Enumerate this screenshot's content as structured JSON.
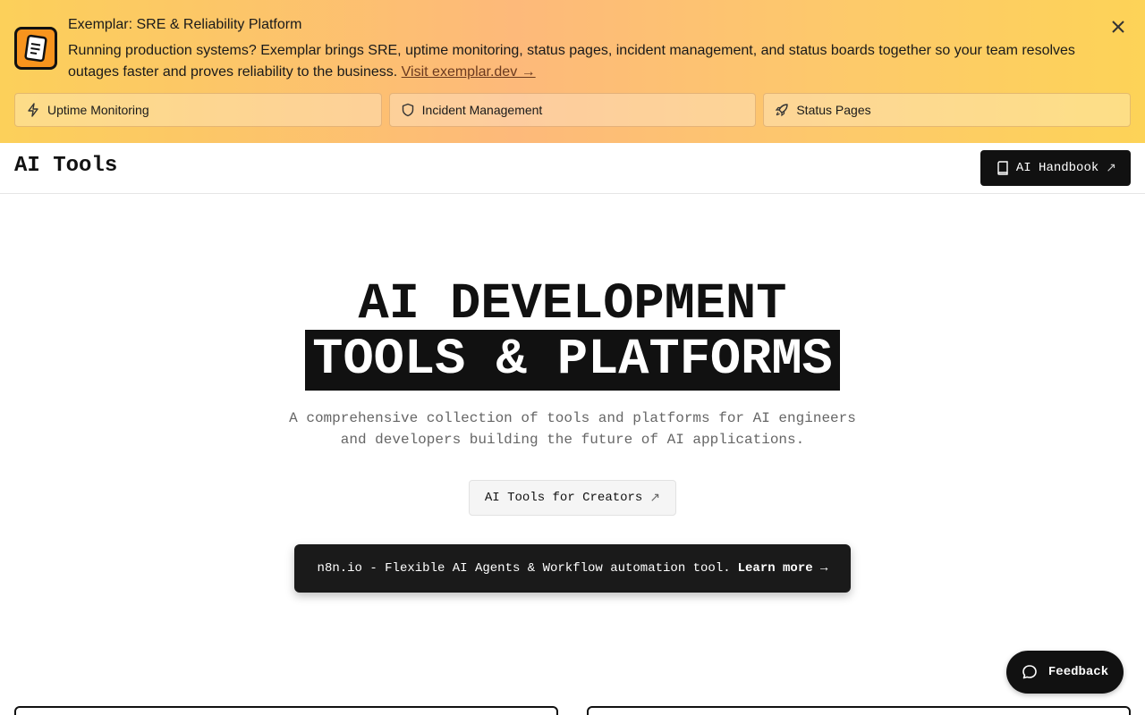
{
  "banner": {
    "title": "Exemplar: SRE & Reliability Platform",
    "text": "Running production systems? Exemplar brings SRE, uptime monitoring, status pages, incident management, and status boards together so your team resolves outages faster and proves reliability to the business. ",
    "link_label": "Visit exemplar.dev →",
    "close_icon": "close-icon",
    "cards": [
      {
        "label": "Uptime Monitoring",
        "icon": "lightning-icon"
      },
      {
        "label": "Incident Management",
        "icon": "shield-icon"
      },
      {
        "label": "Status Pages",
        "icon": "rocket-icon"
      }
    ]
  },
  "header": {
    "title": "AI Tools",
    "handbook_label": "AI Handbook",
    "handbook_ext": "↗"
  },
  "hero": {
    "line1": "AI DEVELOPMENT",
    "line2": "TOOLS & PLATFORMS",
    "description": "A comprehensive collection of tools and platforms for AI engineers and developers building the future of AI applications.",
    "creators_label": "AI Tools for Creators",
    "creators_ext": "↗",
    "promo_text": "n8n.io - Flexible AI Agents & Workflow automation tool.",
    "promo_cta": "Learn more →"
  },
  "feedback": {
    "label": "Feedback"
  },
  "colors": {
    "accent_dark": "#111111",
    "banner_orange": "#fdb97a",
    "banner_yellow": "#fcd05a",
    "logo_orange": "#f7941d"
  }
}
